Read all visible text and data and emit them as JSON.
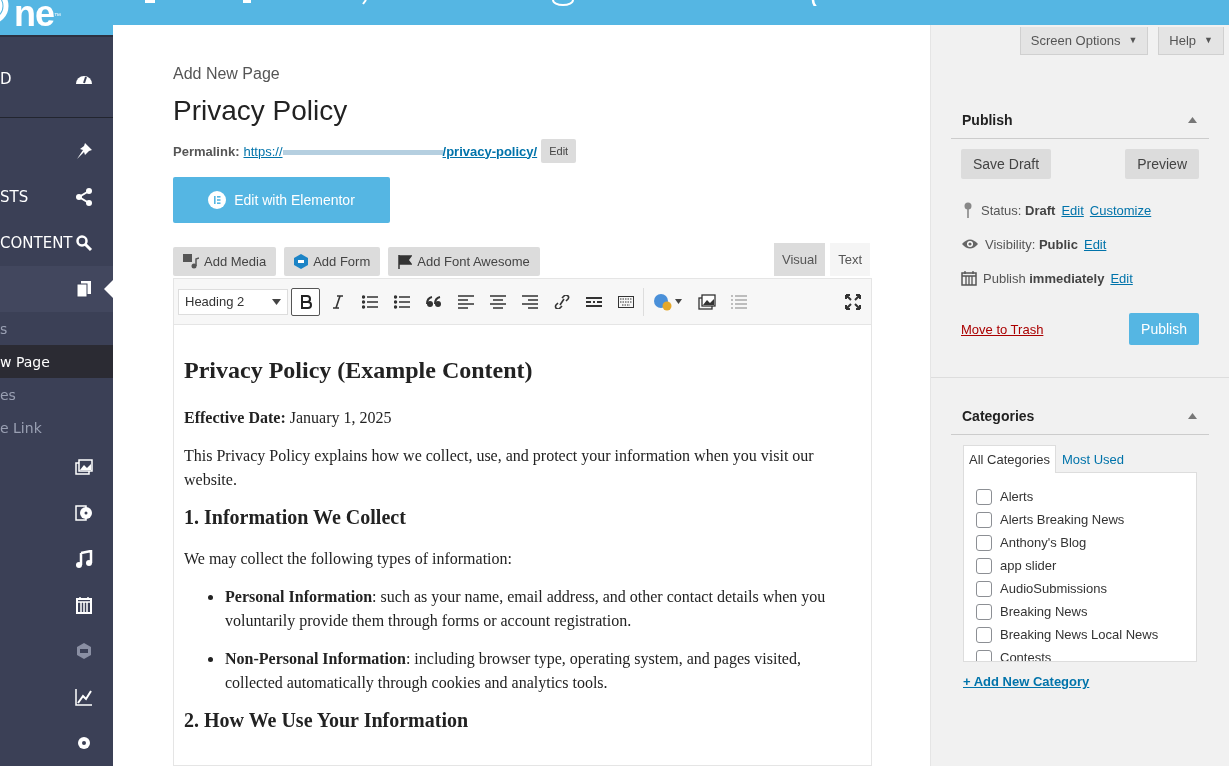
{
  "logo": {
    "text": "ne",
    "mark": "™"
  },
  "sidebar": {
    "items": [
      {
        "kind": "menu",
        "label": "D",
        "selected": false
      },
      {
        "kind": "menu",
        "selected": false
      },
      {
        "kind": "menu",
        "label": "STS",
        "selected": false
      },
      {
        "kind": "menu",
        "label": "CONTENT",
        "selected": false
      },
      {
        "kind": "menu",
        "selected": true
      },
      {
        "kind": "sub",
        "label": "s",
        "selected": false
      },
      {
        "kind": "sub",
        "label": "w Page",
        "selected": true
      },
      {
        "kind": "sub",
        "label": "es",
        "selected": false
      },
      {
        "kind": "sub",
        "label": "e Link",
        "selected": false
      },
      {
        "kind": "menu",
        "selected": false
      },
      {
        "kind": "menu",
        "selected": false
      },
      {
        "kind": "menu",
        "selected": false
      },
      {
        "kind": "menu",
        "selected": false
      },
      {
        "kind": "menu",
        "selected": false
      },
      {
        "kind": "menu",
        "selected": false
      },
      {
        "kind": "menu",
        "selected": false
      }
    ]
  },
  "header_buttons": [
    {
      "label": "Screen Options",
      "caret": "▼"
    },
    {
      "label": "Help",
      "caret": "▼"
    }
  ],
  "page": {
    "heading": "Add New Page",
    "title": "Privacy Policy",
    "permalink": {
      "label": "Permalink:",
      "url_start": "https://",
      "url_end": "/privacy-policy/",
      "edit": "Edit"
    },
    "elementor_button": "Edit with Elementor",
    "media_buttons": [
      "Add Media",
      "Add Form",
      "Add Font Awesome"
    ],
    "editor_tabs": [
      {
        "label": "Visual",
        "selected": true
      },
      {
        "label": "Text",
        "selected": false
      }
    ],
    "toolbar": {
      "format": "Heading 2",
      "bold_active": true
    },
    "content": [
      {
        "kind": "h2",
        "text": "Privacy Policy (Example Content)"
      },
      {
        "kind": "p",
        "text": "**Effective Date:** January 1, 2025"
      },
      {
        "kind": "p",
        "text": "This Privacy Policy explains how we collect, use, and protect your information when you visit our website."
      },
      {
        "kind": "h3",
        "text": "1. Information We Collect"
      },
      {
        "kind": "p",
        "text": "We may collect the following types of information:"
      },
      {
        "kind": "li",
        "text": "**Personal Information**: such as your name, email address, and other contact details when you voluntarily provide them through forms or account registration."
      },
      {
        "kind": "li",
        "text": "**Non-Personal Information**: including browser type, operating system, and pages visited, collected automatically through cookies and analytics tools."
      },
      {
        "kind": "h3",
        "text": "2. How We Use Your Information"
      }
    ]
  },
  "publish": {
    "title": "Publish",
    "save_draft": "Save Draft",
    "preview": "Preview",
    "status": {
      "label": "Status:",
      "value": "Draft",
      "edit": "Edit",
      "customize": "Customize"
    },
    "visibility": {
      "label": "Visibility:",
      "value": "Public",
      "edit": "Edit"
    },
    "schedule": {
      "label": "Publish",
      "value": "immediately",
      "edit": "Edit"
    },
    "trash": "Move to Trash",
    "publish_button": "Publish"
  },
  "categories": {
    "title": "Categories",
    "tabs": [
      {
        "label": "All Categories",
        "selected": true
      },
      {
        "label": "Most Used",
        "selected": false
      }
    ],
    "items": [
      {
        "label": "Alerts",
        "checked": false
      },
      {
        "label": "Alerts Breaking News",
        "checked": false
      },
      {
        "label": "Anthony's Blog",
        "checked": false
      },
      {
        "label": "app slider",
        "checked": false
      },
      {
        "label": "AudioSubmissions",
        "checked": false
      },
      {
        "label": "Breaking News",
        "checked": false
      },
      {
        "label": "Breaking News Local News",
        "checked": false
      },
      {
        "label": "Contests",
        "checked": false
      }
    ],
    "add_link": "+ Add New Category"
  }
}
